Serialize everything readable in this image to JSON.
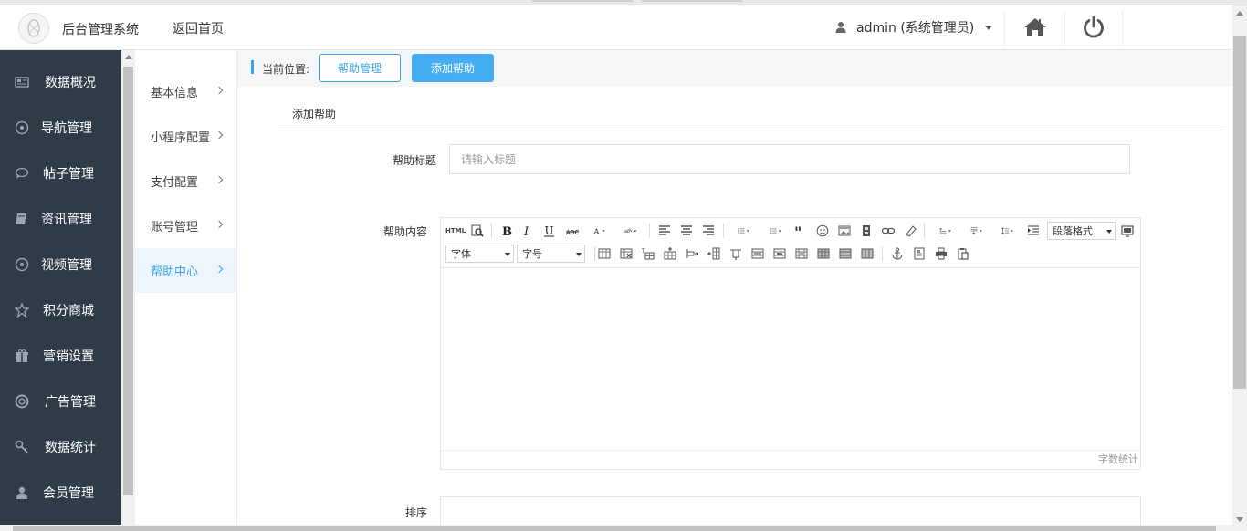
{
  "header": {
    "app_title": "后台管理系统",
    "back_home": "返回首页",
    "user_label": "admin (系统管理员)"
  },
  "sidebar": {
    "items": [
      {
        "label": "数据概况",
        "icon": "dashboard-icon"
      },
      {
        "label": "导航管理",
        "icon": "compass-icon"
      },
      {
        "label": "帖子管理",
        "icon": "comment-icon"
      },
      {
        "label": "资讯管理",
        "icon": "book-icon"
      },
      {
        "label": "视频管理",
        "icon": "compass-icon"
      },
      {
        "label": "积分商城",
        "icon": "star-icon"
      },
      {
        "label": "营销设置",
        "icon": "gift-icon"
      },
      {
        "label": "广告管理",
        "icon": "lifebuoy-icon"
      },
      {
        "label": "数据统计",
        "icon": "key-icon"
      },
      {
        "label": "会员管理",
        "icon": "user-icon"
      }
    ]
  },
  "subnav": {
    "items": [
      {
        "label": "基本信息"
      },
      {
        "label": "小程序配置"
      },
      {
        "label": "支付配置"
      },
      {
        "label": "账号管理"
      },
      {
        "label": "帮助中心"
      }
    ],
    "active_index": 4
  },
  "breadcrumb": {
    "label": "当前位置:",
    "btn_manage": "帮助管理",
    "btn_add": "添加帮助"
  },
  "form": {
    "tab_title": "添加帮助",
    "title_label": "帮助标题",
    "title_placeholder": "请输入标题",
    "content_label": "帮助内容",
    "sort_label": "排序",
    "sort_value": ""
  },
  "editor": {
    "paragraph_select": "段落格式",
    "font_select": "字体",
    "size_select": "字号",
    "html_label": "HTML",
    "word_count": "字数统计"
  },
  "colors": {
    "accent": "#3aa3e3",
    "sidebar_bg": "#2f3b47"
  }
}
